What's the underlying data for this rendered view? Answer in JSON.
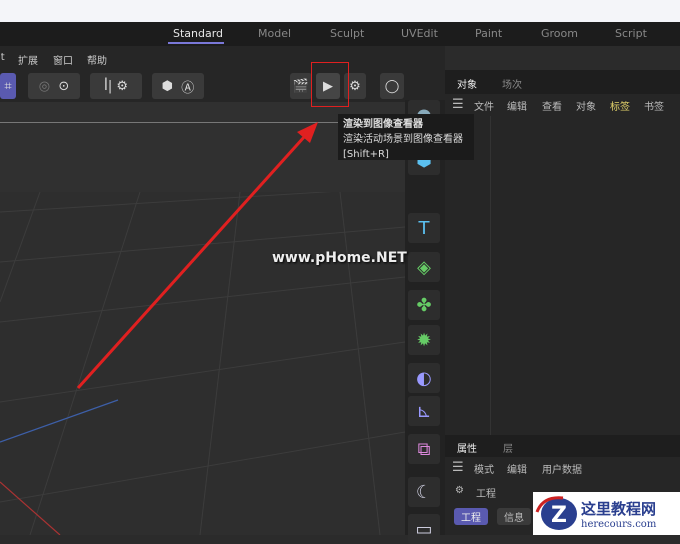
{
  "layout_tabs": [
    "Standard",
    "Model",
    "Sculpt",
    "UVEdit",
    "Paint",
    "Groom",
    "Script"
  ],
  "active_layout": "Standard",
  "menu": [
    "lt",
    "扩展",
    "窗口",
    "帮助"
  ],
  "object_panel": {
    "tabs": [
      "对象",
      "场次"
    ],
    "menu": [
      "文件",
      "编辑",
      "查看",
      "对象",
      "标签",
      "书签"
    ]
  },
  "attr_panel": {
    "tabs": [
      "属性",
      "层"
    ],
    "menu": [
      "模式",
      "编辑",
      "用户数据"
    ],
    "section": "工程",
    "buttons": [
      "工程",
      "信息"
    ]
  },
  "tooltip": {
    "title": "渲染到图像查看器",
    "desc": "渲染活动场景到图像查看器",
    "shortcut": "[Shift+R]"
  },
  "watermark": "www.pHome.NET",
  "logo": {
    "text": "这里教程网",
    "url_text": "herecours.com"
  },
  "colors": {
    "accent": "#7a78d8",
    "annotation": "#e02020",
    "highlight_tab": "#e3d26a"
  }
}
